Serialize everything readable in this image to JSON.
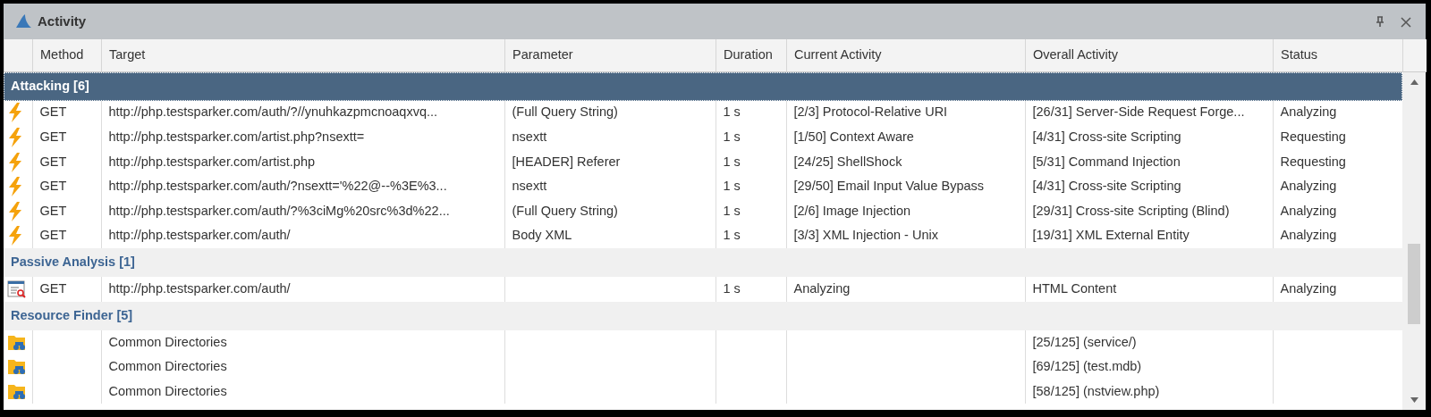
{
  "window": {
    "title": "Activity"
  },
  "columns": [
    "Method",
    "Target",
    "Parameter",
    "Duration",
    "Current Activity",
    "Overall Activity",
    "Status"
  ],
  "groups": [
    {
      "label": "Attacking [6]",
      "selected": true,
      "rows": [
        {
          "kind": "attack",
          "method": "GET",
          "target": "http://php.testsparker.com/auth/?//ynuhkazpmcnoaqxvq...",
          "parameter": "(Full Query String)",
          "duration": "1 s",
          "current_activity": "[2/3] Protocol-Relative URI",
          "overall_activity": "[26/31] Server-Side Request Forge...",
          "status": "Analyzing"
        },
        {
          "kind": "attack",
          "method": "GET",
          "target": "http://php.testsparker.com/artist.php?nsextt=",
          "parameter": "nsextt",
          "duration": "1 s",
          "current_activity": "[1/50] Context Aware",
          "overall_activity": "[4/31] Cross-site Scripting",
          "status": "Requesting"
        },
        {
          "kind": "attack",
          "method": "GET",
          "target": "http://php.testsparker.com/artist.php",
          "parameter": "[HEADER] Referer",
          "duration": "1 s",
          "current_activity": "[24/25] ShellShock",
          "overall_activity": "[5/31] Command Injection",
          "status": "Requesting"
        },
        {
          "kind": "attack",
          "method": "GET",
          "target": "http://php.testsparker.com/auth/?nsextt='%22@--%3E%3...",
          "parameter": "nsextt",
          "duration": "1 s",
          "current_activity": "[29/50] Email Input Value Bypass",
          "overall_activity": "[4/31] Cross-site Scripting",
          "status": "Analyzing"
        },
        {
          "kind": "attack",
          "method": "GET",
          "target": "http://php.testsparker.com/auth/?%3ciMg%20src%3d%22...",
          "parameter": "(Full Query String)",
          "duration": "1 s",
          "current_activity": "[2/6] Image Injection",
          "overall_activity": "[29/31] Cross-site Scripting (Blind)",
          "status": "Analyzing"
        },
        {
          "kind": "attack",
          "method": "GET",
          "target": "http://php.testsparker.com/auth/",
          "parameter": "Body XML",
          "duration": "1 s",
          "current_activity": "[3/3] XML Injection - Unix",
          "overall_activity": "[19/31] XML External Entity",
          "status": "Analyzing"
        }
      ]
    },
    {
      "label": "Passive Analysis [1]",
      "selected": false,
      "rows": [
        {
          "kind": "passive",
          "method": "GET",
          "target": "http://php.testsparker.com/auth/",
          "duration": "1 s",
          "current_activity": "Analyzing",
          "overall_activity": "HTML Content",
          "status": "Analyzing"
        }
      ]
    },
    {
      "label": "Resource Finder [5]",
      "selected": false,
      "rows": [
        {
          "kind": "resource",
          "target": "Common Directories",
          "overall_activity": "[25/125] (service/)"
        },
        {
          "kind": "resource",
          "target": "Common Directories",
          "overall_activity": "[69/125] (test.mdb)"
        },
        {
          "kind": "resource",
          "target": "Common Directories",
          "overall_activity": "[58/125] (nstview.php)"
        }
      ]
    }
  ]
}
